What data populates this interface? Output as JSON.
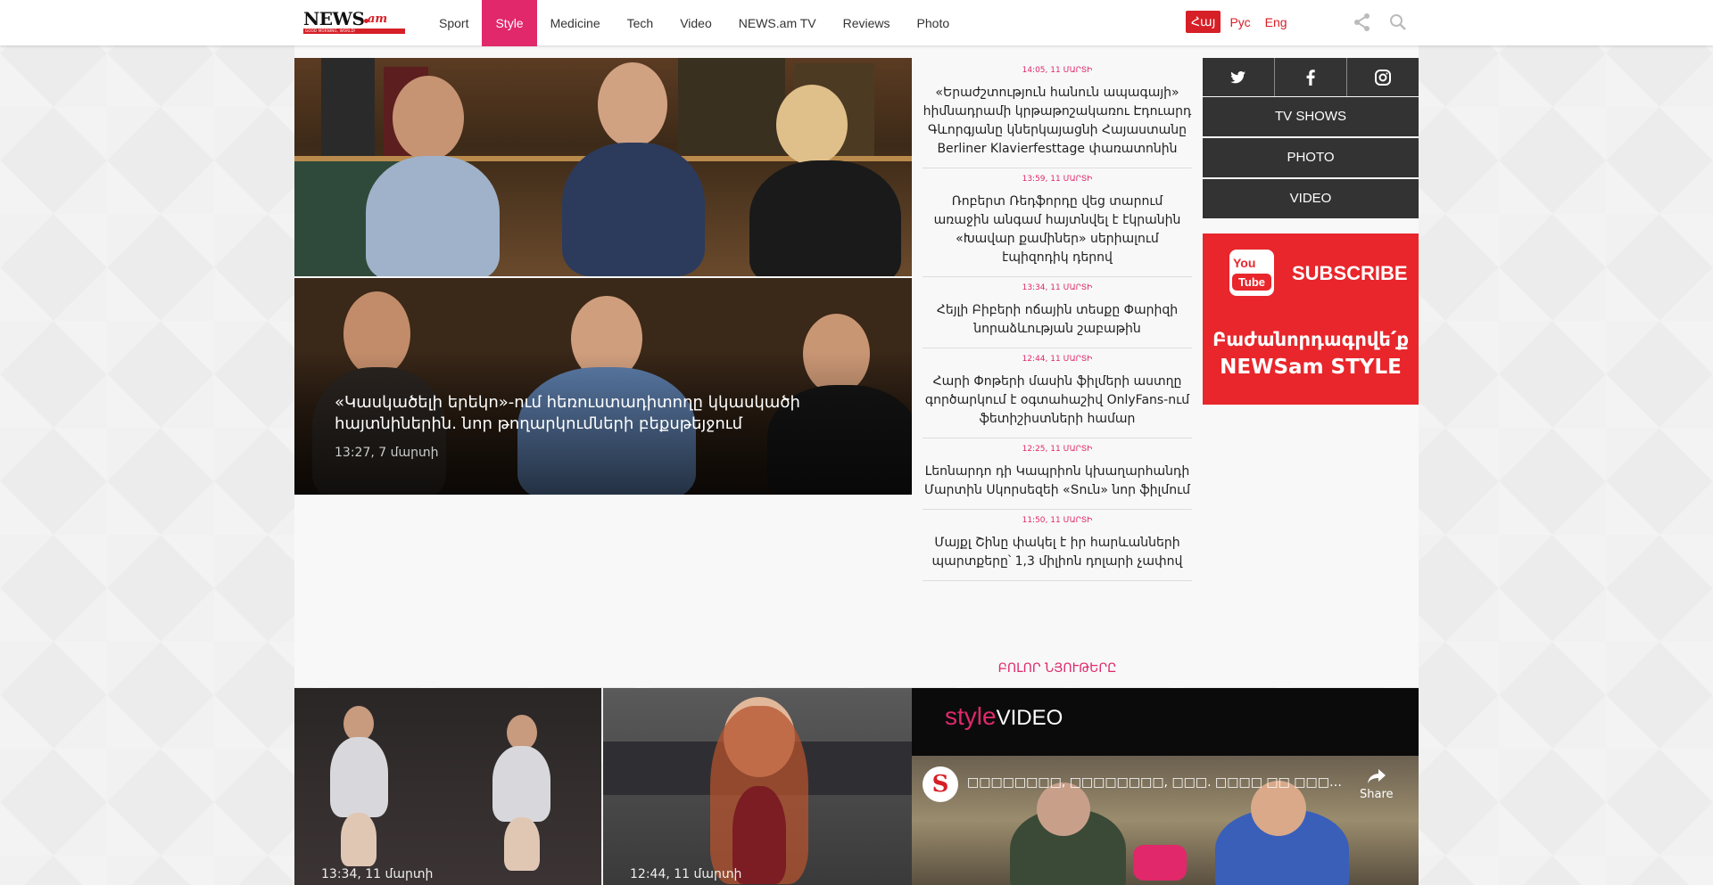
{
  "header": {
    "logo_text": "NEWS",
    "logo_suffix": "am",
    "logo_tagline": "GOOD MORNING, WORLD!",
    "nav": [
      {
        "label": "Sport",
        "active": false
      },
      {
        "label": "Style",
        "active": true
      },
      {
        "label": "Medicine",
        "active": false
      },
      {
        "label": "Tech",
        "active": false
      },
      {
        "label": "Video",
        "active": false
      },
      {
        "label": "NEWS.am TV",
        "active": false
      },
      {
        "label": "Reviews",
        "active": false
      },
      {
        "label": "Photo",
        "active": false
      }
    ],
    "languages": [
      {
        "label": "Հայ",
        "active": true
      },
      {
        "label": "Рус",
        "active": false
      },
      {
        "label": "Eng",
        "active": false
      }
    ],
    "accent_color": "#e0286a",
    "brand_red": "#d61f26"
  },
  "hero": {
    "title": "«Կասկածելի երեկո»-ում հեռուստադիտողը կկասկածի հայտնիներին. նոր թողարկումների բեքսթեյջում",
    "time": "13:27, 7 մարտի"
  },
  "news_list": [
    {
      "time": "14:05, 11 ՄԱՐՏԻ",
      "title": "«Երաժշտություն հանուն ապագայի» հիմնադրամի կրթաթոշակառու Էդուարդ Գևորգյանը կներկայացնի Հայաստանը Berliner Klavierfesttage փառատոնին"
    },
    {
      "time": "13:59, 11 ՄԱՐՏԻ",
      "title": "Ռոբերտ Ռեդֆորդը վեց տարում առաջին անգամ հայտնվել է էկրանին «Խավար քամիներ» սերիալում էպիզոդիկ դերով"
    },
    {
      "time": "13:34, 11 ՄԱՐՏԻ",
      "title": "Հեյլի Բիբերի ոճային տեսքը Փարիզի նորաձևության շաբաթին"
    },
    {
      "time": "12:44, 11 ՄԱՐՏԻ",
      "title": "Հարի Փոթերի մասին ֆիլմերի աստղը գործարկում է օգտահաշիվ OnlyFans-ում ֆետիշիստների համար"
    },
    {
      "time": "12:25, 11 ՄԱՐՏԻ",
      "title": "Լեոնարդո դի Կապրիոն կխաղարհանդի Մարտին Սկորսեզեի «Տուն» նոր ֆիլմում"
    },
    {
      "time": "11:50, 11 ՄԱՐՏԻ",
      "title": "Մայքլ Շինը փակել է իր հարևանների պարտքերը՝ 1,3 միլիոն դոլարի չափով"
    }
  ],
  "all_materials_label": "ԲՈԼՈՐ ՆՅՈՒԹԵՐԸ",
  "sidebar": {
    "social": [
      {
        "icon": "twitter-icon"
      },
      {
        "icon": "facebook-icon"
      },
      {
        "icon": "instagram-icon"
      }
    ],
    "buttons": [
      "TV SHOWS",
      "PHOTO",
      "VIDEO"
    ],
    "subscribe": {
      "yt_you": "You",
      "yt_tube": "Tube",
      "label": "SUBSCRIBE",
      "line1": "Բաժանորդագրվե՛ք",
      "line2": "NEWSam STYLE"
    }
  },
  "bottom_tiles": [
    {
      "time": "13:34, 11 մարտի"
    },
    {
      "time": "12:44, 11 մարտի"
    }
  ],
  "style_video": {
    "brand_style": "style",
    "brand_video": "VIDEO",
    "avatar_letter": "S",
    "video_title": "□□□□□□□□, □□□□□□□□, □□□. □□□□ □□ □□□□□□□□□ □□□□□□ □□□□□ ...",
    "share_label": "Share"
  }
}
